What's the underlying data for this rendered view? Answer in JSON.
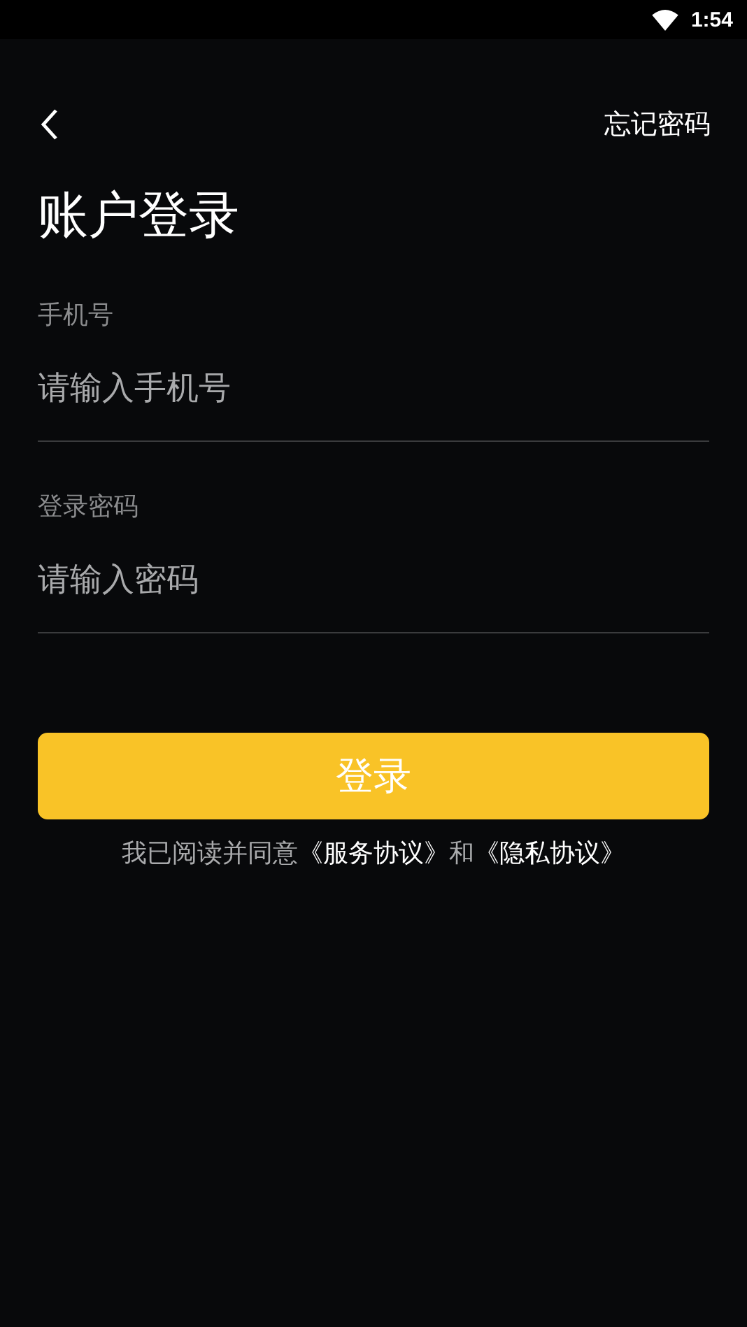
{
  "status_bar": {
    "time": "1:54"
  },
  "nav": {
    "forgot_password": "忘记密码"
  },
  "title": "账户登录",
  "fields": [
    {
      "label": "手机号",
      "placeholder": "请输入手机号"
    },
    {
      "label": "登录密码",
      "placeholder": "请输入密码"
    }
  ],
  "login_button": "登录",
  "agreement": {
    "prefix": "我已阅读并同意",
    "link_1": "《服务协议》",
    "joiner": "和",
    "link_2": "《隐私协议》"
  }
}
